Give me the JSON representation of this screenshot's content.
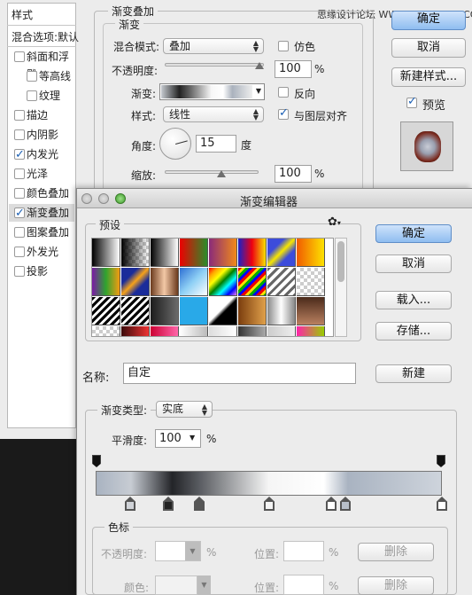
{
  "watermark": "思缘设计论坛 WWW.MISSYUAN.COM",
  "styles_sidebar": {
    "header": "样式",
    "blend_label": "混合选项:默认",
    "items": [
      {
        "label": "斜面和浮雕",
        "checked": false
      },
      {
        "label": "等高线",
        "checked": false
      },
      {
        "label": "纹理",
        "checked": false
      },
      {
        "label": "描边",
        "checked": false
      },
      {
        "label": "内阴影",
        "checked": false
      },
      {
        "label": "内发光",
        "checked": true
      },
      {
        "label": "光泽",
        "checked": false
      },
      {
        "label": "颜色叠加",
        "checked": false
      },
      {
        "label": "渐变叠加",
        "checked": true
      },
      {
        "label": "图案叠加",
        "checked": false
      },
      {
        "label": "外发光",
        "checked": false
      },
      {
        "label": "投影",
        "checked": false
      }
    ]
  },
  "gradient_overlay": {
    "group_title": "渐变叠加",
    "sub_title": "渐变",
    "blend_mode_label": "混合模式:",
    "blend_mode_value": "叠加",
    "dither_label": "仿色",
    "opacity_label": "不透明度:",
    "opacity_value": "100",
    "percent": "%",
    "gradient_label": "渐变:",
    "reverse_label": "反向",
    "style_label": "样式:",
    "style_value": "线性",
    "align_label": "与图层对齐",
    "angle_label": "角度:",
    "angle_value": "15",
    "degree": "度",
    "scale_label": "缩放:",
    "scale_value": "100"
  },
  "right_buttons": {
    "ok": "确定",
    "cancel": "取消",
    "new_style": "新建样式...",
    "preview": "预览"
  },
  "gradient_editor": {
    "title": "渐变编辑器",
    "presets_label": "预设",
    "ok": "确定",
    "cancel": "取消",
    "load": "载入...",
    "save": "存储...",
    "name_label": "名称:",
    "name_value": "自定",
    "new_button": "新建",
    "type_label": "渐变类型:",
    "type_value": "实底",
    "smooth_label": "平滑度:",
    "smooth_value": "100",
    "percent": "%",
    "color_stops_title": "色标",
    "opacity_label": "不透明度:",
    "position_label": "位置:",
    "delete_label": "删除",
    "color_label": "颜色:",
    "stops": [
      {
        "position": 0.1,
        "color": "#d0d3d8"
      },
      {
        "position": 0.21,
        "color": "#222"
      },
      {
        "position": 0.3,
        "color": "#555"
      },
      {
        "position": 0.5,
        "color": "#f4f4f4"
      },
      {
        "position": 0.68,
        "color": "#fff"
      },
      {
        "position": 0.72,
        "color": "#b8bfc9"
      },
      {
        "position": 1,
        "color": "#fff"
      }
    ]
  }
}
